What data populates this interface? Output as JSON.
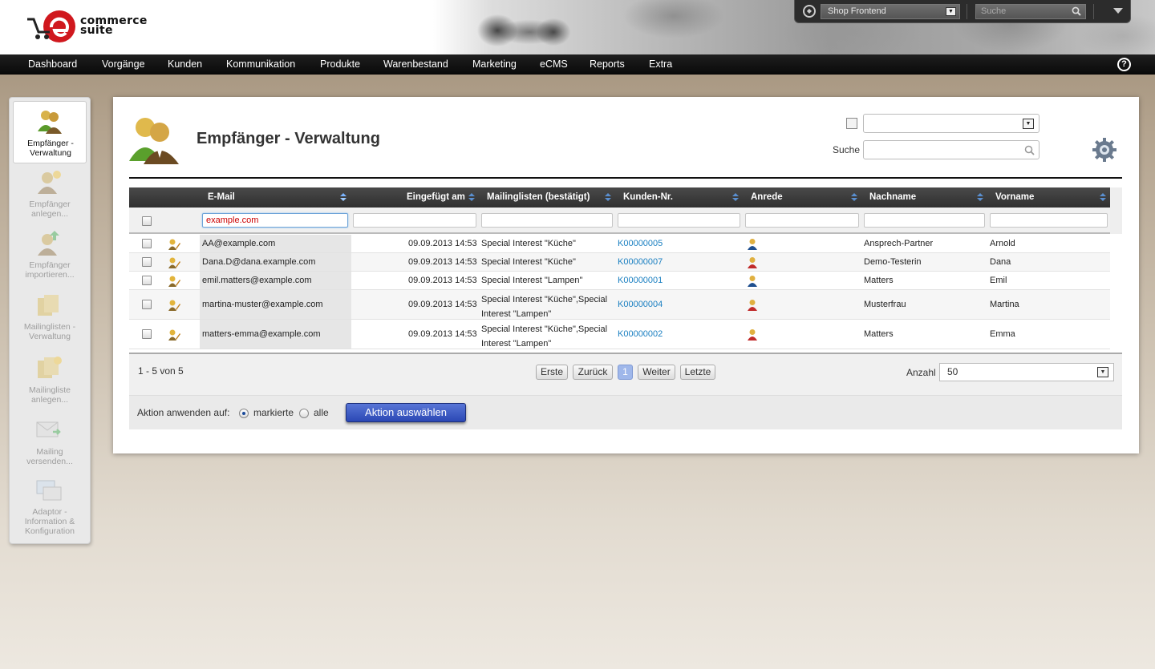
{
  "brand": {
    "line1": "commerce",
    "line2": "suite"
  },
  "topbar": {
    "shop_selected": "Shop Frontend",
    "search_placeholder": "Suche"
  },
  "nav": [
    "Dashboard",
    "Vorgänge",
    "Kunden",
    "Kommunikation",
    "Produkte",
    "Warenbestand",
    "Marketing",
    "eCMS",
    "Reports",
    "Extra"
  ],
  "sidebar": [
    {
      "label": "Empfänger - Verwaltung",
      "active": true
    },
    {
      "label": "Empfänger anlegen...",
      "active": false
    },
    {
      "label": "Empfänger importieren...",
      "active": false
    },
    {
      "label": "Mailinglisten - Verwaltung",
      "active": false
    },
    {
      "label": "Mailingliste anlegen...",
      "active": false
    },
    {
      "label": "Mailing versenden...",
      "active": false
    },
    {
      "label": "Adaptor - Information & Konfiguration",
      "active": false
    }
  ],
  "page": {
    "title": "Empfänger - Verwaltung",
    "search_label": "Suche"
  },
  "grid": {
    "columns": [
      "E-Mail",
      "Eingefügt am",
      "Mailinglisten (bestätigt)",
      "Kunden-Nr.",
      "Anrede",
      "Nachname",
      "Vorname"
    ],
    "filters": {
      "email": "example.com"
    },
    "rows": [
      {
        "email": "AA@example.com",
        "inserted": "09.09.2013 14:53",
        "lists": [
          "Special Interest \"Küche\""
        ],
        "customer": "K00000005",
        "salutation": "male",
        "lastname": "Ansprech-Partner",
        "firstname": "Arnold"
      },
      {
        "email": "Dana.D@dana.example.com",
        "inserted": "09.09.2013 14:53",
        "lists": [
          "Special Interest \"Küche\""
        ],
        "customer": "K00000007",
        "salutation": "female",
        "lastname": "Demo-Testerin",
        "firstname": "Dana"
      },
      {
        "email": "emil.matters@example.com",
        "inserted": "09.09.2013 14:53",
        "lists": [
          "Special Interest \"Lampen\""
        ],
        "customer": "K00000001",
        "salutation": "male",
        "lastname": "Matters",
        "firstname": "Emil"
      },
      {
        "email": "martina-muster@example.com",
        "inserted": "09.09.2013 14:53",
        "lists": [
          "Special Interest \"Küche\",Special",
          "Interest \"Lampen\""
        ],
        "customer": "K00000004",
        "salutation": "female",
        "lastname": "Musterfrau",
        "firstname": "Martina"
      },
      {
        "email": "matters-emma@example.com",
        "inserted": "09.09.2013 14:53",
        "lists": [
          "Special Interest \"Küche\",Special",
          "Interest \"Lampen\""
        ],
        "customer": "K00000002",
        "salutation": "female",
        "lastname": "Matters",
        "firstname": "Emma"
      }
    ]
  },
  "pager": {
    "count": "1 - 5 von 5",
    "first": "Erste",
    "prev": "Zurück",
    "current": "1",
    "next": "Weiter",
    "last": "Letzte",
    "size_label": "Anzahl",
    "size_value": "50"
  },
  "action": {
    "label": "Aktion anwenden auf:",
    "option_marked": "markierte",
    "option_all": "alle",
    "button": "Aktion auswählen"
  },
  "colors": {
    "link": "#1a7fc1",
    "action_button": "#3b5bc8",
    "filter_text": "#cc0000"
  }
}
